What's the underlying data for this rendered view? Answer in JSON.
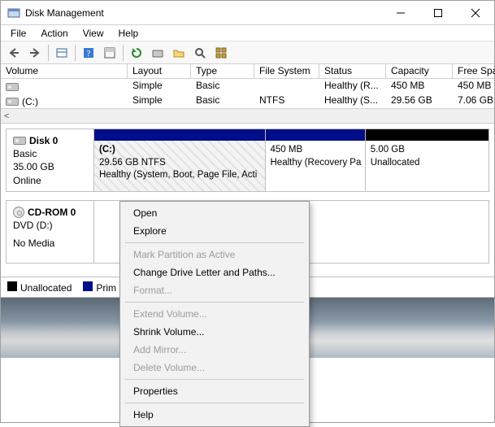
{
  "titlebar": {
    "title": "Disk Management"
  },
  "menus": {
    "file": "File",
    "action": "Action",
    "view": "View",
    "help": "Help"
  },
  "columns": {
    "volume": "Volume",
    "layout": "Layout",
    "type": "Type",
    "fs": "File System",
    "status": "Status",
    "capacity": "Capacity",
    "free": "Free Spa..."
  },
  "volumes": [
    {
      "name": "",
      "layout": "Simple",
      "type": "Basic",
      "fs": "",
      "status": "Healthy (R...",
      "capacity": "450 MB",
      "free": "450 MB"
    },
    {
      "name": "(C:)",
      "layout": "Simple",
      "type": "Basic",
      "fs": "NTFS",
      "status": "Healthy (S...",
      "capacity": "29.56 GB",
      "free": "7.06 GB"
    }
  ],
  "scroll_hint": "<",
  "disk0": {
    "name": "Disk 0",
    "type": "Basic",
    "size": "35.00 GB",
    "state": "Online",
    "parts": [
      {
        "title": "(C:)",
        "line2": "29.56 GB NTFS",
        "line3": "Healthy (System, Boot, Page File, Acti"
      },
      {
        "title": "",
        "line2": "450 MB",
        "line3": "Healthy (Recovery Pa"
      },
      {
        "title": "",
        "line2": "5.00 GB",
        "line3": "Unallocated"
      }
    ]
  },
  "cdrom": {
    "name": "CD-ROM 0",
    "type": "DVD (D:)",
    "state": "No Media"
  },
  "legend": {
    "unallocated": "Unallocated",
    "primary": "Prim"
  },
  "context_menu": {
    "open": "Open",
    "explore": "Explore",
    "mark_active": "Mark Partition as Active",
    "change_letter": "Change Drive Letter and Paths...",
    "format": "Format...",
    "extend": "Extend Volume...",
    "shrink": "Shrink Volume...",
    "add_mirror": "Add Mirror...",
    "delete": "Delete Volume...",
    "properties": "Properties",
    "help": "Help"
  }
}
